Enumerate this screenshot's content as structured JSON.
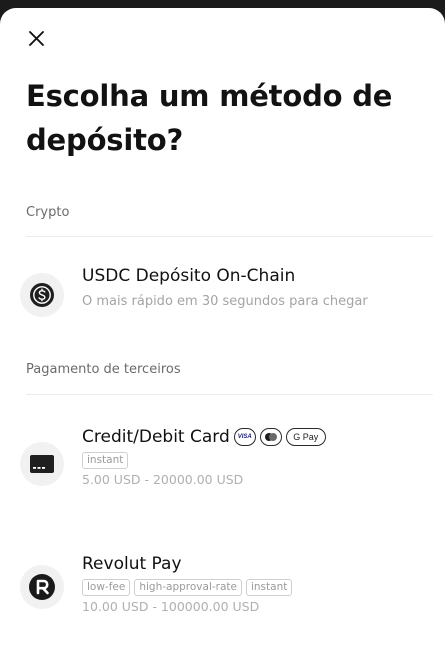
{
  "header": {
    "close_icon": "close-icon",
    "title": "Escolha um método de depósito?"
  },
  "sections": [
    {
      "label": "Crypto",
      "methods": [
        {
          "icon": "usdc-icon",
          "title": "USDC Depósito On-Chain",
          "subtitle": "O mais rápido em 30 segundos para chegar"
        }
      ]
    },
    {
      "label": "Pagamento de terceiros",
      "methods": [
        {
          "icon": "credit-card-icon",
          "title": "Credit/Debit Card",
          "badges": [
            "VISA",
            "mastercard",
            "G Pay"
          ],
          "tags": [
            "instant"
          ],
          "range": "5.00 USD - 20000.00 USD"
        },
        {
          "icon": "revolut-icon",
          "title": "Revolut Pay",
          "tags": [
            "low-fee",
            "high-approval-rate",
            "instant"
          ],
          "range": "10.00 USD - 100000.00 USD"
        }
      ]
    }
  ],
  "colors": {
    "background_dark": "#1b1b1b",
    "sheet": "#ffffff",
    "text_primary": "#121212",
    "text_secondary": "#a4a4a4"
  }
}
